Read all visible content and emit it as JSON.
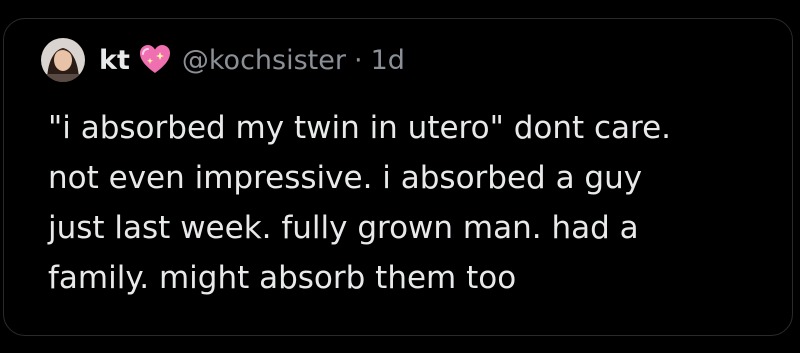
{
  "tweet": {
    "display_name": "kt",
    "emoji_icon": "sparkling-heart-icon",
    "handle": "@kochsister",
    "separator": "·",
    "time": "1d",
    "lines": [
      "\"i absorbed my twin in utero\" dont care.",
      "not even impressive. i absorbed a guy",
      "just last week. fully grown man. had a",
      "family. might absorb them too"
    ]
  },
  "colors": {
    "background": "#000000",
    "text": "#e7e9ea",
    "secondary_text": "#8b9096",
    "heart": "#f06fb1"
  }
}
